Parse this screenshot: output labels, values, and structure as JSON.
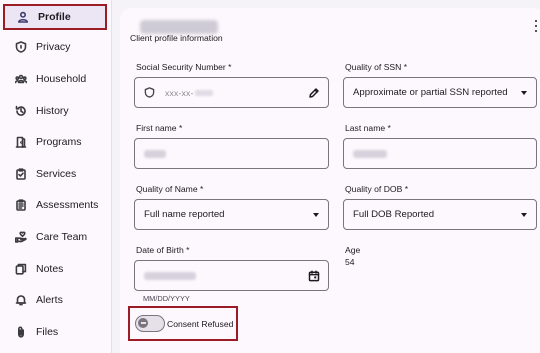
{
  "sidebar": {
    "items": [
      {
        "label": "Profile",
        "icon": "person-icon",
        "active": true
      },
      {
        "label": "Privacy",
        "icon": "shield-icon"
      },
      {
        "label": "Household",
        "icon": "people-icon"
      },
      {
        "label": "History",
        "icon": "history-icon"
      },
      {
        "label": "Programs",
        "icon": "door-icon"
      },
      {
        "label": "Services",
        "icon": "clipboard-check-icon"
      },
      {
        "label": "Assessments",
        "icon": "clipboard-list-icon"
      },
      {
        "label": "Care Team",
        "icon": "hand-heart-icon"
      },
      {
        "label": "Notes",
        "icon": "notes-icon"
      },
      {
        "label": "Alerts",
        "icon": "bell-icon"
      },
      {
        "label": "Files",
        "icon": "paperclip-icon"
      }
    ]
  },
  "card": {
    "subtitle": "Client profile information"
  },
  "form": {
    "ssn": {
      "label": "Social Security Number *",
      "value": "xxx-xx-"
    },
    "ssn_quality": {
      "label": "Quality of SSN *",
      "value": "Approximate or partial SSN reported"
    },
    "first_name": {
      "label": "First name *"
    },
    "last_name": {
      "label": "Last name *"
    },
    "name_quality": {
      "label": "Quality of Name *",
      "value": "Full name reported"
    },
    "dob_quality": {
      "label": "Quality of DOB *",
      "value": "Full DOB Reported"
    },
    "dob": {
      "label": "Date of Birth *",
      "hint": "MM/DD/YYYY"
    },
    "age": {
      "label": "Age",
      "value": "54"
    },
    "consent": {
      "label": "Consent Refused",
      "checked": false
    }
  },
  "colors": {
    "highlight": "#9b1c26",
    "active_nav_bg": "#ece6f4",
    "surface": "#fdf8fd",
    "outline": "#79747e"
  }
}
